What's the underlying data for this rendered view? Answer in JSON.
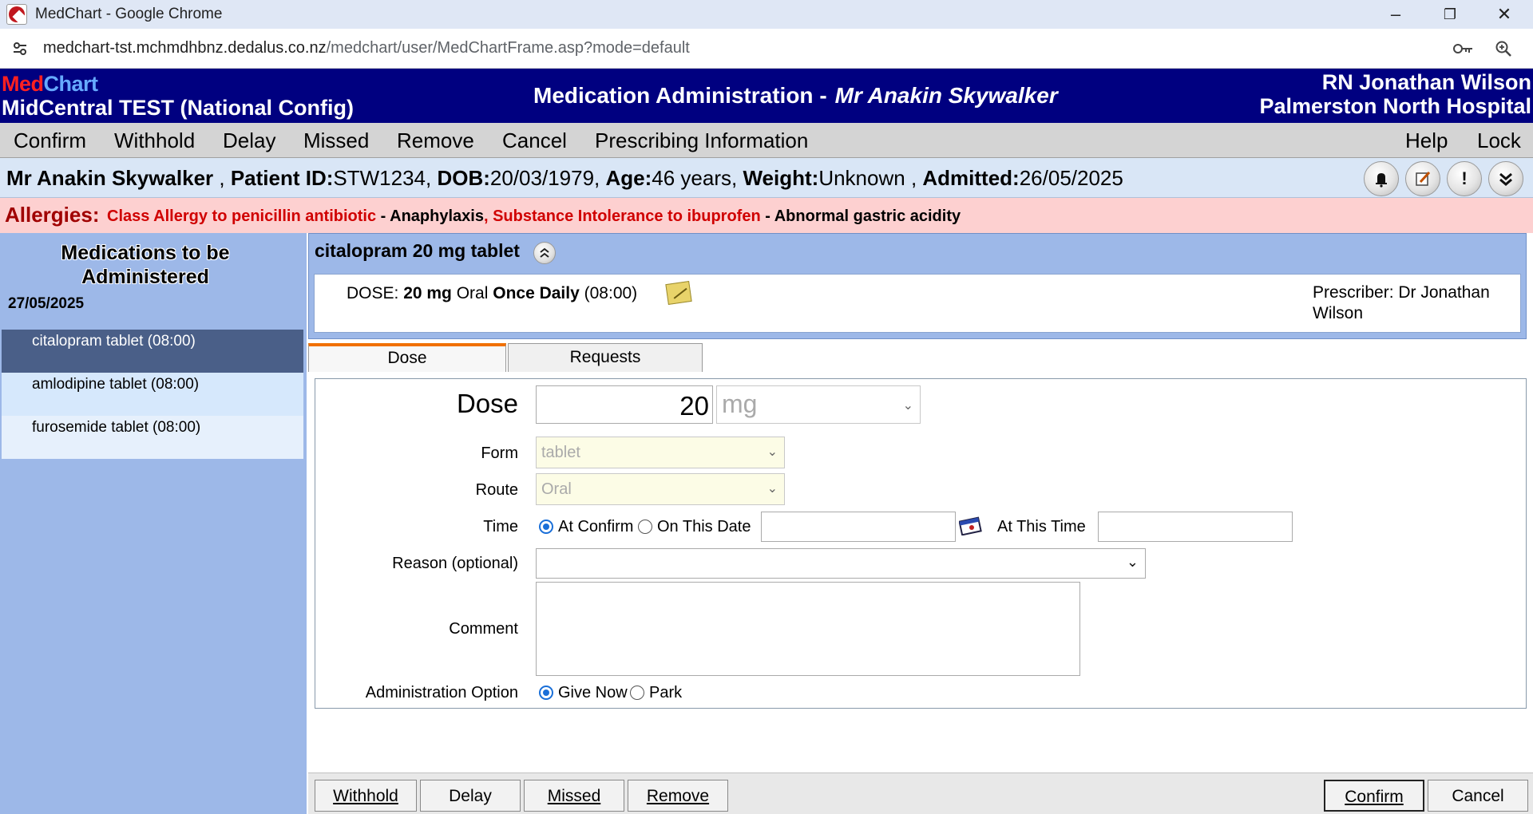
{
  "browser": {
    "window_title": "MedChart - Google Chrome",
    "url_host": "medchart-tst.mchmdhbnz.dedalus.co.nz",
    "url_path": "/medchart/user/MedChartFrame.asp?mode=default",
    "controls": {
      "minimize": "–",
      "restore": "❐",
      "close": "✕"
    }
  },
  "header": {
    "logo_med": "Med",
    "logo_chart": "Chart",
    "org": "MidCentral TEST (National Config)",
    "screen_title": "Medication Administration -",
    "patient_name": "Mr Anakin Skywalker",
    "user": "RN Jonathan Wilson",
    "hospital": "Palmerston North Hospital"
  },
  "menu": {
    "confirm": "Confirm",
    "withhold": "Withhold",
    "delay": "Delay",
    "missed": "Missed",
    "remove": "Remove",
    "cancel": "Cancel",
    "prescribing": "Prescribing Information",
    "help": "Help",
    "lock": "Lock"
  },
  "patient": {
    "name": "Mr Anakin Skywalker",
    "id_label": "Patient ID:",
    "id": "STW1234",
    "dob_label": "DOB:",
    "dob": "20/03/1979",
    "age_label": "Age:",
    "age": "46 years",
    "weight_label": "Weight:",
    "weight": "Unknown",
    "admitted_label": "Admitted:",
    "admitted": "26/05/2025"
  },
  "allergies": {
    "label": "Allergies:",
    "a1": "Class Allergy to penicillin antibiotic",
    "a1_reaction": " - Anaphylaxis",
    "a2": ", Substance Intolerance to ibuprofen",
    "a2_reaction": " - Abnormal gastric acidity"
  },
  "sidebar": {
    "heading_line1": "Medications to be",
    "heading_line2": "Administered",
    "date": "27/05/2025",
    "items": [
      {
        "label": "citalopram tablet (08:00)"
      },
      {
        "label": "amlodipine tablet (08:00)"
      },
      {
        "label": "furosemide tablet (08:00)"
      }
    ]
  },
  "medication": {
    "title": "citalopram 20 mg tablet",
    "dose_prefix": "DOSE: ",
    "dose_amount": "20 mg",
    "dose_route": " Oral ",
    "dose_freq": "Once Daily",
    "dose_time": " (08:00)",
    "prescriber_line1": "Prescriber: Dr Jonathan",
    "prescriber_line2": "Wilson"
  },
  "tabs": {
    "dose": "Dose",
    "requests": "Requests"
  },
  "form": {
    "dose_label": "Dose",
    "dose_value": "20",
    "dose_unit": "mg",
    "form_label": "Form",
    "form_value": "tablet",
    "route_label": "Route",
    "route_value": "Oral",
    "time_label": "Time",
    "time_opt1": "At Confirm",
    "time_opt2": "On This Date",
    "date_value": "",
    "at_time_label": "At This Time",
    "time_value": "",
    "reason_label": "Reason (optional)",
    "reason_value": "",
    "comment_label": "Comment",
    "comment_value": "",
    "admin_label": "Administration Option",
    "admin_opt1": "Give Now",
    "admin_opt2": "Park"
  },
  "buttons": {
    "withhold": "Withhold",
    "delay": "Delay",
    "missed": "Missed",
    "remove": "Remove",
    "confirm": "Confirm",
    "cancel": "Cancel"
  }
}
